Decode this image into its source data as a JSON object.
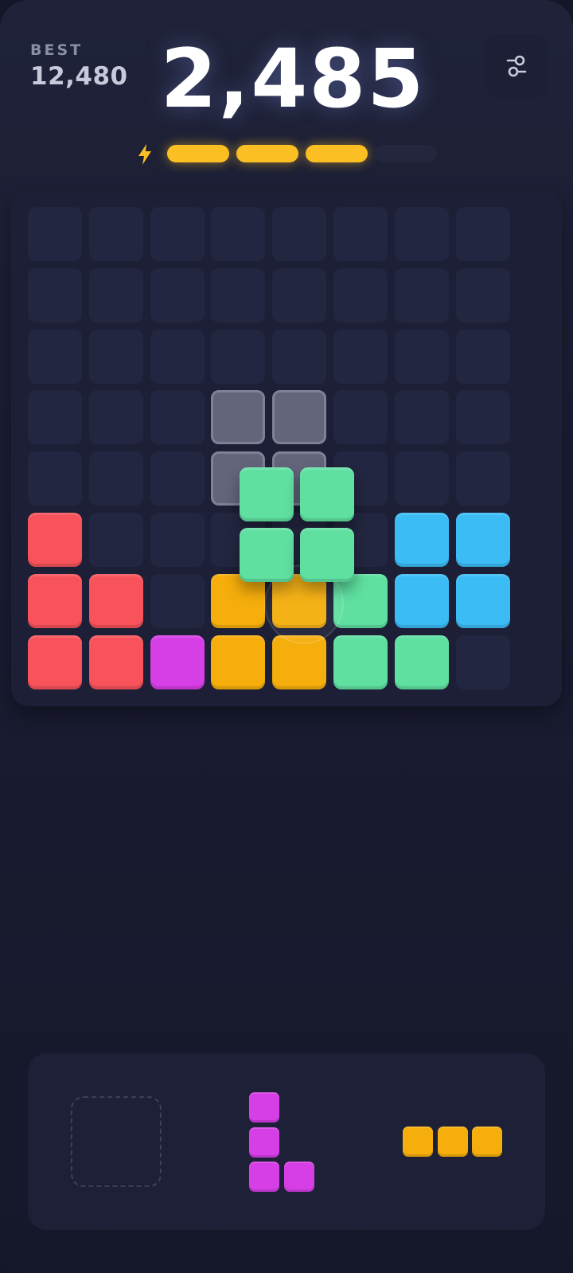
{
  "header": {
    "best_label": "BEST",
    "best_value": "12,480",
    "score": "2,485",
    "settings_icon": "sliders-icon"
  },
  "combo": {
    "icon": "lightning-icon",
    "segments_total": 4,
    "segments_filled": 3,
    "color_on": "#fbbf24",
    "color_off": "#23263d"
  },
  "colors": {
    "red": "#f8525a",
    "magenta": "#d63ee6",
    "orange": "#f5ae0b",
    "green": "#5fe0a1",
    "blue": "#3bbcf5"
  },
  "board": {
    "rows": 8,
    "cols": 8,
    "cells": [
      "........",
      "........",
      "........",
      "........",
      "........",
      "R.....BB",
      "RR.OOGBB",
      "RRMOOGG."
    ],
    "placement_preview": [
      [
        3,
        3
      ],
      [
        3,
        4
      ],
      [
        4,
        3
      ],
      [
        4,
        4
      ]
    ],
    "dragging_piece": {
      "color": "green",
      "shape": "square-2x2"
    }
  },
  "tray": {
    "slots": [
      {
        "state": "empty"
      },
      {
        "state": "piece",
        "color": "magenta",
        "shape": "L-3x2",
        "cells": [
          [
            0,
            0
          ],
          [
            1,
            0
          ],
          [
            2,
            0
          ],
          [
            2,
            1
          ]
        ]
      },
      {
        "state": "piece",
        "color": "orange",
        "shape": "I-1x3",
        "cells": [
          [
            0,
            0
          ],
          [
            0,
            1
          ],
          [
            0,
            2
          ]
        ]
      }
    ]
  }
}
